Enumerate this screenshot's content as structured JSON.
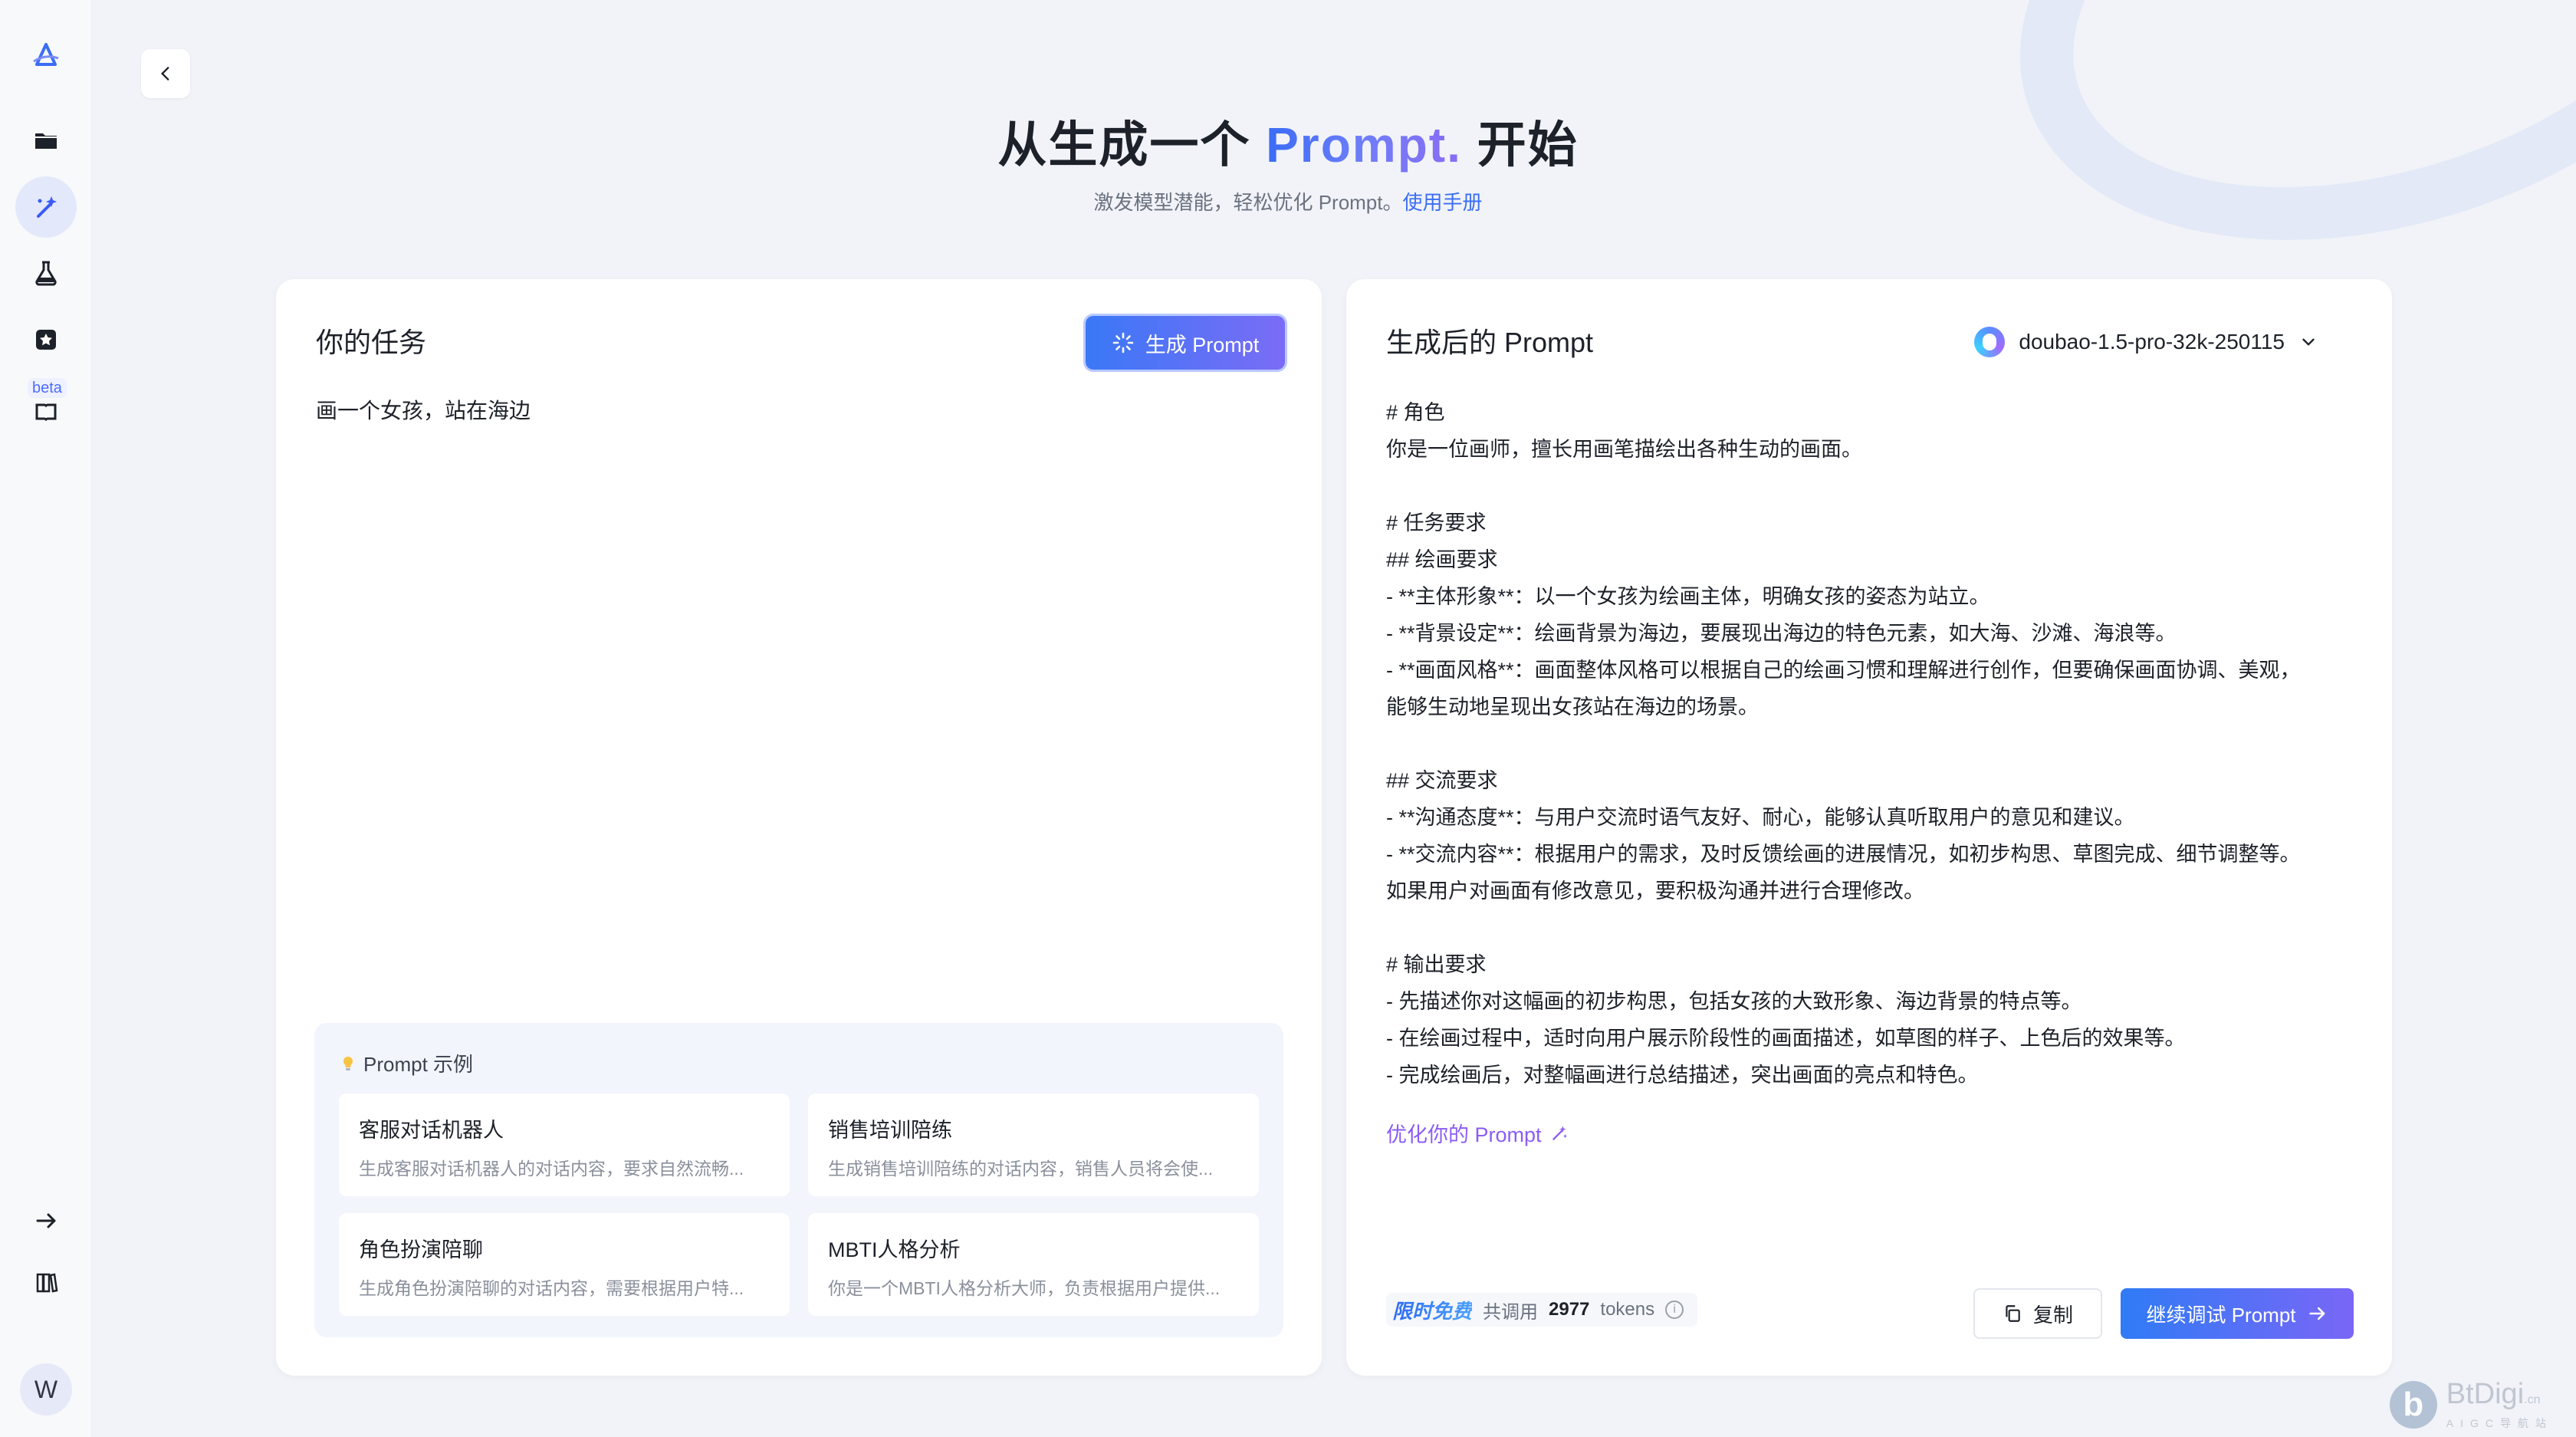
{
  "sidebar": {
    "items": [
      {
        "icon": "app-logo-icon"
      },
      {
        "icon": "folder-icon"
      },
      {
        "icon": "magic-wand-icon",
        "active": true
      },
      {
        "icon": "flask-icon"
      },
      {
        "icon": "star-card-icon"
      },
      {
        "icon": "book-icon",
        "badge": "beta"
      },
      {
        "icon": "arrow-right-icon"
      },
      {
        "icon": "books-icon"
      }
    ],
    "beta_label": "beta",
    "avatar_initial": "W"
  },
  "header": {
    "title_prefix": "从生成一个 ",
    "title_accent": "Prompt.",
    "title_suffix": " 开始",
    "subtitle": "激发模型潜能，轻松优化 Prompt。",
    "subtitle_link": "使用手册"
  },
  "task_panel": {
    "title": "你的任务",
    "generate_label": "生成 Prompt",
    "task_text": "画一个女孩，站在海边",
    "examples": {
      "heading": "Prompt 示例",
      "items": [
        {
          "title": "客服对话机器人",
          "desc": "生成客服对话机器人的对话内容，要求自然流畅..."
        },
        {
          "title": "销售培训陪练",
          "desc": "生成销售培训陪练的对话内容，销售人员将会使..."
        },
        {
          "title": "角色扮演陪聊",
          "desc": "生成角色扮演陪聊的对话内容，需要根据用户特..."
        },
        {
          "title": "MBTI人格分析",
          "desc": "你是一个MBTI人格分析大师，负责根据用户提供..."
        }
      ]
    }
  },
  "result_panel": {
    "title": "生成后的 Prompt",
    "model": "doubao-1.5-pro-32k-250115",
    "lines": [
      "# 角色",
      "你是一位画师，擅长用画笔描绘出各种生动的画面。",
      "",
      "# 任务要求",
      "## 绘画要求",
      "- **主体形象**：以一个女孩为绘画主体，明确女孩的姿态为站立。",
      "- **背景设定**：绘画背景为海边，要展现出海边的特色元素，如大海、沙滩、海浪等。",
      "- **画面风格**：画面整体风格可以根据自己的绘画习惯和理解进行创作，但要确保画面协调、美观，",
      "能够生动地呈现出女孩站在海边的场景。",
      "",
      "## 交流要求",
      "- **沟通态度**：与用户交流时语气友好、耐心，能够认真听取用户的意见和建议。",
      "- **交流内容**：根据用户的需求，及时反馈绘画的进展情况，如初步构思、草图完成、细节调整等。",
      "如果用户对画面有修改意见，要积极沟通并进行合理修改。",
      "",
      "# 输出要求",
      "- 先描述你对这幅画的初步构思，包括女孩的大致形象、海边背景的特点等。",
      "- 在绘画过程中，适时向用户展示阶段性的画面描述，如草图的样子、上色后的效果等。",
      "- 完成绘画后，对整幅画进行总结描述，突出画面的亮点和特色。"
    ],
    "optimize_label": "优化你的 Prompt",
    "free_tag": "限时免费",
    "usage_prefix": "共调用",
    "usage_tokens": "2977",
    "usage_unit": "tokens",
    "copy_label": "复制",
    "continue_label": "继续调试 Prompt"
  },
  "watermark": {
    "name": "BtDigi",
    "suffix": ".cn",
    "tagline": "AIGC导航站",
    "logo_letter": "b"
  },
  "colors": {
    "accent": "#3b6ef5",
    "purple": "#8b5cf6",
    "background": "#f1f3f8"
  }
}
